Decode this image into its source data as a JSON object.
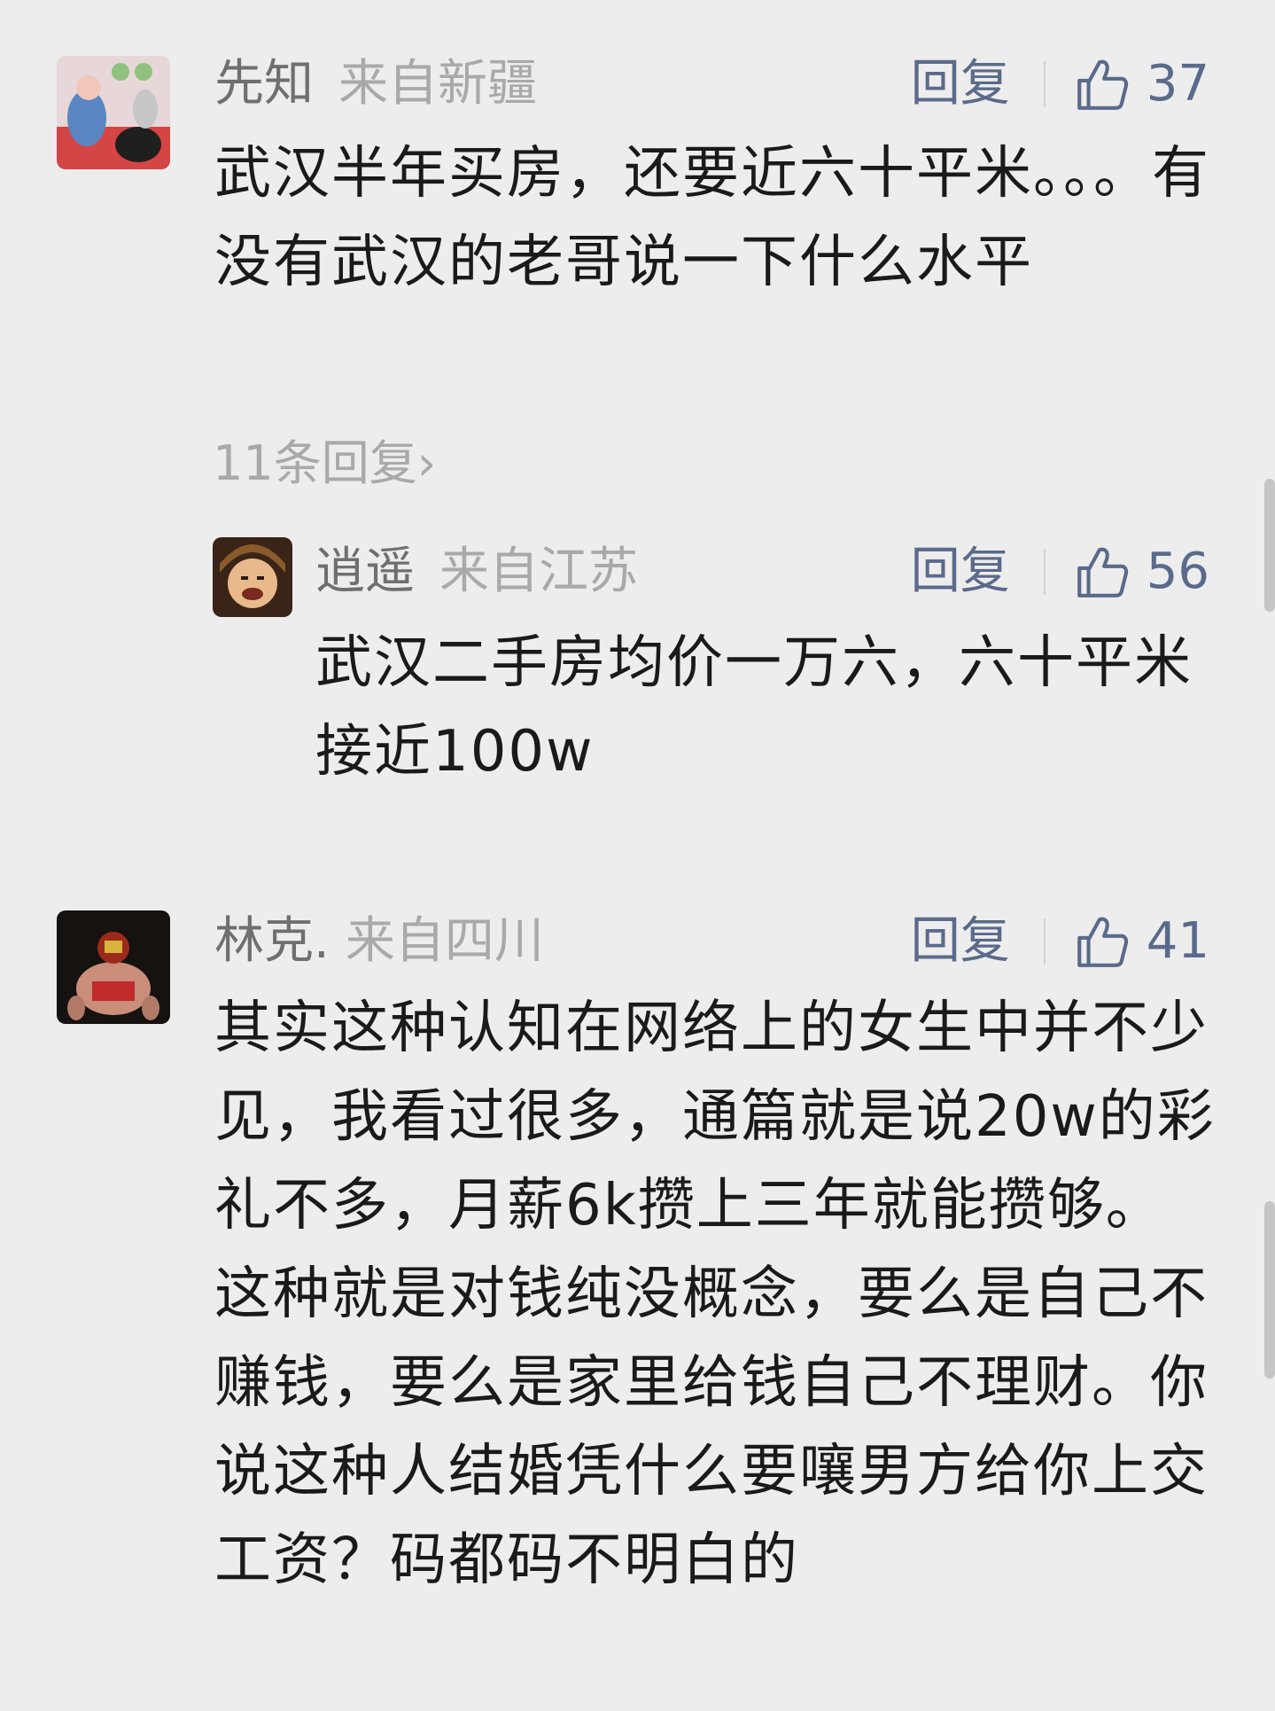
{
  "comments": [
    {
      "username": "先知",
      "location": "来自新疆",
      "reply_label": "回复",
      "likes": "37",
      "text": "武汉半年买房，还要近六十平米。。。有没有武汉的老哥说一下什么水平",
      "replies_link": "11条回复",
      "replies_chevron": "›",
      "sub_reply": {
        "username": "逍遥",
        "location": "来自江苏",
        "reply_label": "回复",
        "likes": "56",
        "text": "武汉二手房均价一万六，六十平米接近100w"
      }
    },
    {
      "username": "林克.",
      "location": "来自四川",
      "reply_label": "回复",
      "likes": "41",
      "text": "其实这种认知在网络上的女生中并不少见，我看过很多，通篇就是说20w的彩礼不多，月薪6k攒上三年就能攒够。这种就是对钱纯没概念，要么是自己不赚钱，要么是家里给钱自己不理财。你说这种人结婚凭什么要嚷男方给你上交工资？码都码不明白的"
    }
  ],
  "icons": {
    "like": "thumbs-up-icon",
    "chevron": "chevron-right-icon"
  },
  "colors": {
    "background": "#ededed",
    "username": "#6f6f6f",
    "location": "#a9a9a9",
    "action_blue": "#5a6a8a",
    "body_text": "#1a1a1a"
  }
}
